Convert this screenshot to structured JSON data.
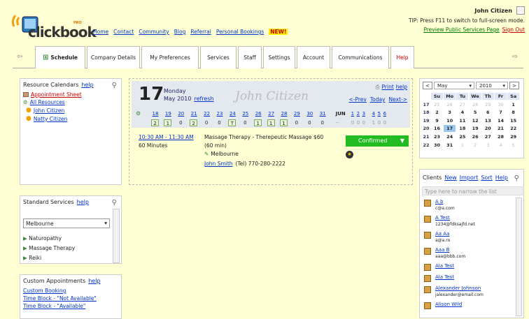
{
  "logo": {
    "text": "clickbook",
    "sup": "PRO"
  },
  "nav": [
    "Home",
    "Contact",
    "Community",
    "Blog",
    "Referral",
    "Personal Bookings"
  ],
  "nav_new": "NEW!",
  "user": {
    "name": "John Citizen"
  },
  "tip": "TIP: Press F11 to switch to full-screen mode.",
  "preview_link": "Preview Public Services Page",
  "signout": "Sign Out",
  "tabs": [
    "Schedule",
    "Company Details",
    "My Preferences",
    "Services",
    "Staff",
    "Settings",
    "Account",
    "Communications",
    "Help"
  ],
  "resource": {
    "title": "Resource Calendars",
    "help": "help",
    "appointment_sheet": "Appointment Sheet",
    "all_resources": "All Resources",
    "people": [
      "John Citizen",
      "Natty Citizen"
    ]
  },
  "services": {
    "title": "Standard Services",
    "help": "help",
    "location": "Melbourne",
    "items": [
      "Naturopathy",
      "Massage Therapy",
      "Reiki"
    ]
  },
  "custom": {
    "title": "Custom Appointments",
    "help": "help",
    "items": [
      "Custom Booking",
      "Time Block - \"Not Available\"",
      "Time Block - \"Available\""
    ]
  },
  "schedule": {
    "day_number": "17",
    "day_name": "Monday",
    "month_year": "May 2010",
    "refresh": "refresh",
    "name": "John Citizen",
    "print": "Print",
    "help": "help",
    "prev": "<-Prev",
    "today": "Today",
    "next": "Next->",
    "days": [
      "18",
      "19",
      "20",
      "21",
      "22",
      "23",
      "24",
      "25",
      "26",
      "27",
      "28",
      "29",
      "30",
      "31"
    ],
    "counts": [
      "2",
      "1",
      "0",
      "2",
      "0",
      "0",
      "T",
      "0",
      "1",
      "1",
      "1",
      "0",
      "0",
      "0"
    ],
    "jun_label": "JUN",
    "jun_days": [
      "1",
      "2",
      "3",
      "4",
      "5",
      "6"
    ],
    "jun_counts": [
      "--",
      "0",
      "0",
      "0",
      "1",
      "0",
      "0"
    ],
    "appointment": {
      "time": "10:30 AM - 11:30 AM",
      "duration": "60 Minutes",
      "service": "Massage Therapy - Therepeutic Massage $60",
      "length": "(60 min)",
      "location": "Melbourne",
      "client": "John Smith",
      "phone": "(Tel) 770-280-2222",
      "status": "Confirmed"
    }
  },
  "calendar": {
    "month": "May",
    "year": "2010",
    "prev": "<",
    "next": ">",
    "weekdays": [
      "Su",
      "Mo",
      "Tu",
      "We",
      "Th",
      "Fr",
      "Sa"
    ],
    "weeks": [
      {
        "wk": "17",
        "days": [
          "25",
          "26",
          "27",
          "28",
          "29",
          "30",
          "1"
        ]
      },
      {
        "wk": "18",
        "days": [
          "2",
          "3",
          "4",
          "5",
          "6",
          "7",
          "8"
        ]
      },
      {
        "wk": "19",
        "days": [
          "9",
          "10",
          "11",
          "12",
          "13",
          "14",
          "15"
        ]
      },
      {
        "wk": "20",
        "days": [
          "16",
          "17",
          "18",
          "19",
          "20",
          "21",
          "22"
        ]
      },
      {
        "wk": "21",
        "days": [
          "23",
          "24",
          "25",
          "26",
          "27",
          "28",
          "29"
        ]
      },
      {
        "wk": "22",
        "days": [
          "30",
          "31",
          "1",
          "2",
          "3",
          "4",
          "5"
        ]
      }
    ]
  },
  "clients": {
    "title": "Clients",
    "links": [
      "New",
      "Import",
      "Sort",
      "Help"
    ],
    "filter_placeholder": "Type here to narrow the list",
    "list": [
      {
        "name": "A b",
        "email": "c@a.com"
      },
      {
        "name": "A Test",
        "email": "1234@fdksajfd.net"
      },
      {
        "name": "Aa Aa",
        "email": "a@a.ro"
      },
      {
        "name": "Aaa B",
        "email": "aaa@bbb.com"
      },
      {
        "name": "Ala Test",
        "email": ""
      },
      {
        "name": "Ala Test",
        "email": ""
      },
      {
        "name": "Alexander Johnson",
        "email": "jalexander@email.com"
      },
      {
        "name": "Alison Wild",
        "email": ""
      }
    ]
  },
  "colors": {
    "accent": "#0033cc",
    "confirmed": "#22bb22",
    "help_red": "#cc0000",
    "background": "#ffffd4"
  }
}
